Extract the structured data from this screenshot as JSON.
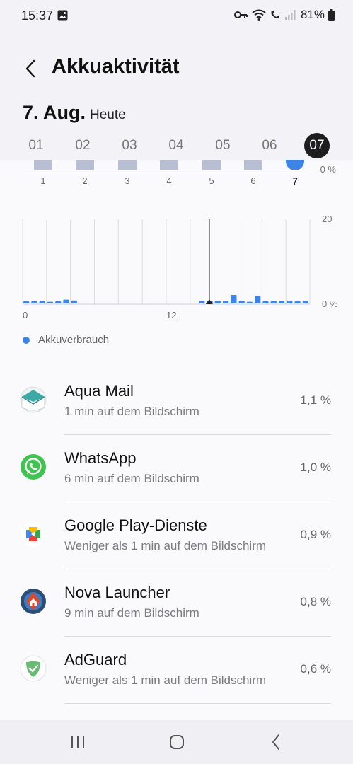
{
  "status_bar": {
    "time": "15:37",
    "battery_percent": "81%",
    "icons": [
      "image-icon",
      "key-icon",
      "wifi-icon",
      "wifi-call-icon",
      "signal-icon",
      "battery-icon"
    ]
  },
  "header": {
    "title": "Akkuaktivität",
    "back_icon": "chevron-left-icon"
  },
  "date": {
    "main": "7. Aug.",
    "sub": "Heute"
  },
  "day_selector": {
    "days": [
      "01",
      "02",
      "03",
      "04",
      "05",
      "06",
      "07"
    ],
    "selected": "07"
  },
  "weekly_chart": {
    "labels": [
      "1",
      "2",
      "3",
      "4",
      "5",
      "6",
      "7"
    ],
    "axis_label": "0 %",
    "today_index": 6
  },
  "chart_data": {
    "type": "bar",
    "series": [
      {
        "name": "Akkuverbrauch",
        "values": [
          0.5,
          0.5,
          0.5,
          0.4,
          0.5,
          0.9,
          0.7,
          0,
          0,
          0,
          0,
          0,
          0,
          0,
          0,
          0,
          0,
          0,
          0,
          0,
          0,
          0,
          0.6,
          0.6,
          0.6,
          0.6,
          2.0,
          0.6,
          0.4,
          1.8,
          0.5,
          0.6,
          0.5,
          0.6,
          0.5,
          0.5
        ]
      }
    ],
    "xlabels": [
      "0",
      "12"
    ],
    "ylabel_top": "20",
    "ylabel_bottom": "0 %",
    "ylim": [
      0,
      20
    ],
    "current_time_hour": 15.6
  },
  "legend": {
    "label": "Akkuverbrauch",
    "color": "#3d84e6"
  },
  "apps": [
    {
      "name": "Aqua Mail",
      "usage": "1 min auf dem Bildschirm",
      "percent": "1,1 %",
      "icon": "aqua-mail-icon"
    },
    {
      "name": "WhatsApp",
      "usage": "6 min auf dem Bildschirm",
      "percent": "1,0 %",
      "icon": "whatsapp-icon"
    },
    {
      "name": "Google Play-Dienste",
      "usage": "Weniger als 1 min auf dem Bildschirm",
      "percent": "0,9 %",
      "icon": "google-play-services-icon"
    },
    {
      "name": "Nova Launcher",
      "usage": "9 min auf dem Bildschirm",
      "percent": "0,8 %",
      "icon": "nova-launcher-icon"
    },
    {
      "name": "AdGuard",
      "usage": "Weniger als 1 min auf dem Bildschirm",
      "percent": "0,6 %",
      "icon": "adguard-icon"
    }
  ],
  "nav_bar": {
    "buttons": [
      "recents-icon",
      "home-icon",
      "back-icon"
    ]
  },
  "colors": {
    "accent": "#3d84e6",
    "week_bar": "#b8bfd2",
    "background": "#f3f3f7"
  }
}
